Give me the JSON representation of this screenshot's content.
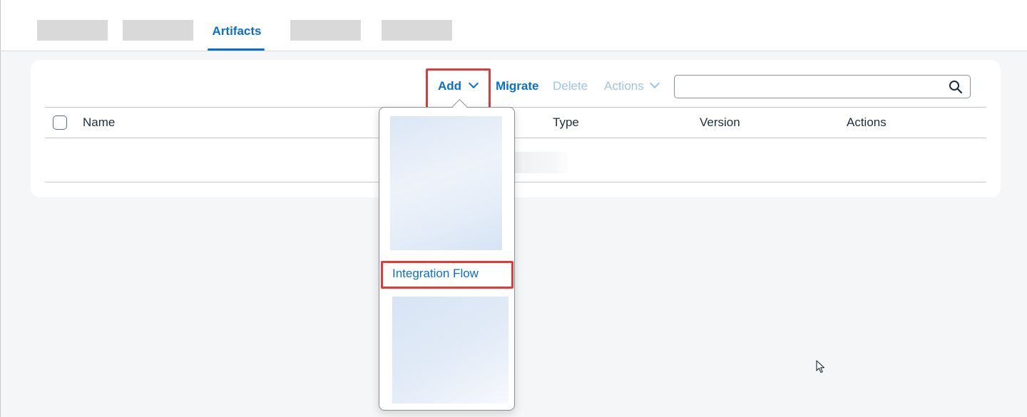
{
  "tabs": {
    "active_label": "Artifacts"
  },
  "toolbar": {
    "add_label": "Add",
    "migrate_label": "Migrate",
    "delete_label": "Delete",
    "actions_label": "Actions",
    "search_value": "",
    "search_placeholder": ""
  },
  "table": {
    "columns": [
      "Name",
      "Type",
      "Version",
      "Actions"
    ]
  },
  "add_menu": {
    "items": [
      "Integration Flow"
    ]
  },
  "colors": {
    "accent": "#0a6ed1",
    "highlight": "#e03a3a"
  },
  "icons": [
    "search-icon",
    "chevron-down-icon",
    "mouse-cursor-icon"
  ]
}
